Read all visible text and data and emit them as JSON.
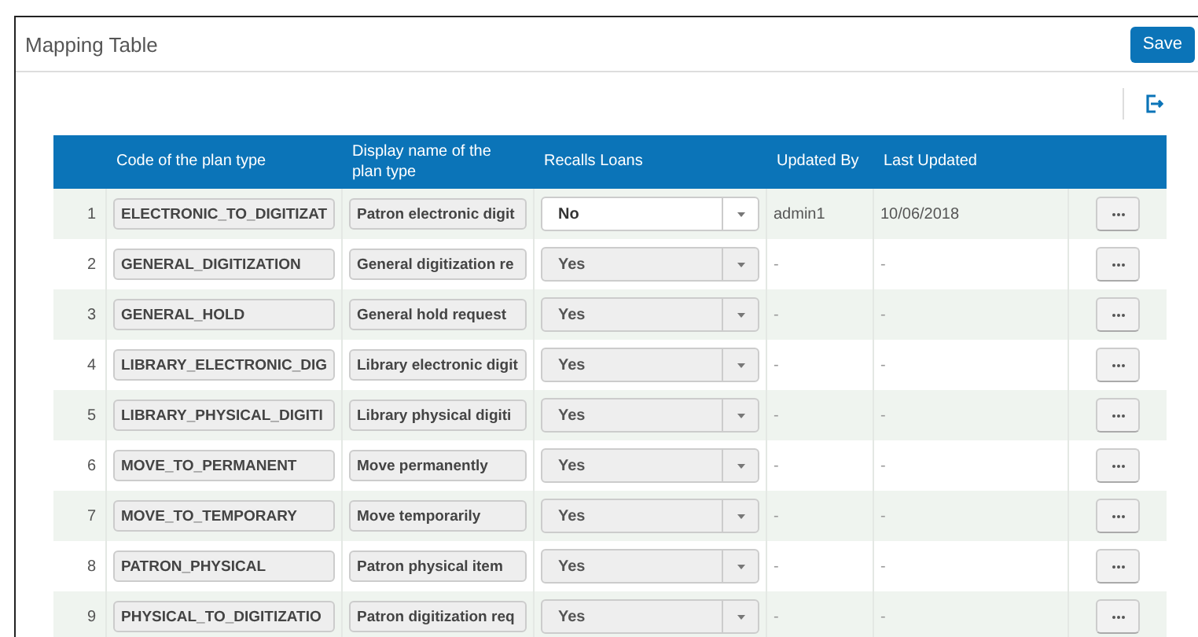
{
  "panel": {
    "title": "Mapping Table",
    "save_button": "Save"
  },
  "table": {
    "columns": [
      "Code of the plan type",
      "Display name of the plan type",
      "Recalls Loans",
      "Updated By",
      "Last Updated"
    ],
    "rows": [
      {
        "number": "1",
        "code": "ELECTRONIC_TO_DIGITIZAT",
        "display_name": "Patron electronic digit",
        "recalls_loans": {
          "value": "No",
          "disabled": false
        },
        "updated_by": "admin1",
        "last_updated": "10/06/2018"
      },
      {
        "number": "2",
        "code": "GENERAL_DIGITIZATION",
        "display_name": "General digitization re",
        "recalls_loans": {
          "value": "Yes",
          "disabled": true
        },
        "updated_by": "-",
        "last_updated": "-"
      },
      {
        "number": "3",
        "code": "GENERAL_HOLD",
        "display_name": "General hold request",
        "recalls_loans": {
          "value": "Yes",
          "disabled": true
        },
        "updated_by": "-",
        "last_updated": "-"
      },
      {
        "number": "4",
        "code": "LIBRARY_ELECTRONIC_DIG",
        "display_name": "Library electronic digit",
        "recalls_loans": {
          "value": "Yes",
          "disabled": true
        },
        "updated_by": "-",
        "last_updated": "-"
      },
      {
        "number": "5",
        "code": "LIBRARY_PHYSICAL_DIGITI",
        "display_name": "Library physical digiti",
        "recalls_loans": {
          "value": "Yes",
          "disabled": true
        },
        "updated_by": "-",
        "last_updated": "-"
      },
      {
        "number": "6",
        "code": "MOVE_TO_PERMANENT",
        "display_name": "Move permanently",
        "recalls_loans": {
          "value": "Yes",
          "disabled": true
        },
        "updated_by": "-",
        "last_updated": "-"
      },
      {
        "number": "7",
        "code": "MOVE_TO_TEMPORARY",
        "display_name": "Move temporarily",
        "recalls_loans": {
          "value": "Yes",
          "disabled": true
        },
        "updated_by": "-",
        "last_updated": "-"
      },
      {
        "number": "8",
        "code": "PATRON_PHYSICAL",
        "display_name": "Patron physical item",
        "recalls_loans": {
          "value": "Yes",
          "disabled": true
        },
        "updated_by": "-",
        "last_updated": "-"
      },
      {
        "number": "9",
        "code": "PHYSICAL_TO_DIGITIZATIO",
        "display_name": "Patron digitization req",
        "recalls_loans": {
          "value": "Yes",
          "disabled": true
        },
        "updated_by": "-",
        "last_updated": "-"
      }
    ]
  }
}
